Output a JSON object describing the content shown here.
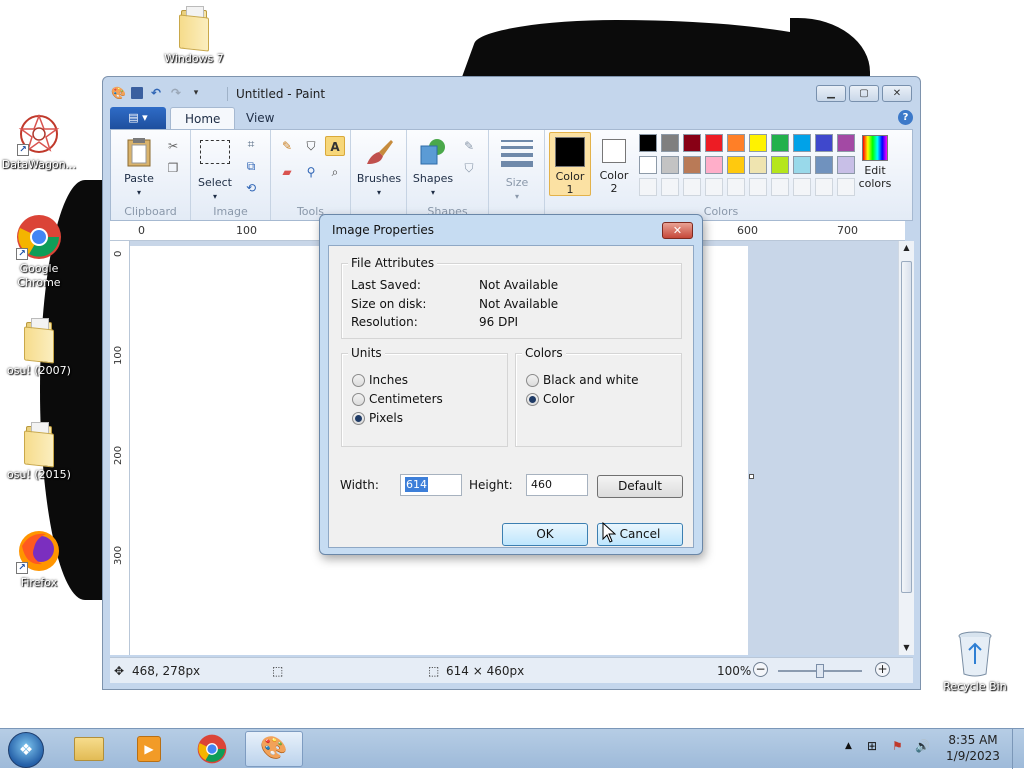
{
  "desktop": {
    "icons": [
      {
        "label": "Windows 7",
        "kind": "folder"
      },
      {
        "label": "DataWagon...",
        "kind": "app"
      },
      {
        "label": "Google Chrome",
        "kind": "chrome"
      },
      {
        "label": "osu! (2007)",
        "kind": "folder"
      },
      {
        "label": "osu! (2015)",
        "kind": "folder"
      },
      {
        "label": "Firefox",
        "kind": "firefox"
      },
      {
        "label": "Recycle Bin",
        "kind": "recycle-bin"
      }
    ]
  },
  "window": {
    "title": "Untitled - Paint",
    "file_menu_label": "",
    "tabs": [
      {
        "label": "Home"
      },
      {
        "label": "View"
      }
    ],
    "active_tab": "Home"
  },
  "ribbon": {
    "groups": {
      "clipboard": {
        "label": "Clipboard",
        "paste_label": "Paste"
      },
      "image": {
        "label": "Image",
        "select_label": "Select"
      },
      "tools": {
        "label": "Tools"
      },
      "brushes": {
        "label": "Brushes"
      },
      "shapes": {
        "label": "Shapes"
      },
      "size": {
        "label": "Size"
      },
      "colors": {
        "label": "Colors",
        "color1_label": "Color\n1",
        "color1_line1": "Color",
        "color1_line2": "1",
        "color2_line1": "Color",
        "color2_line2": "2",
        "edit_line1": "Edit",
        "edit_line2": "colors",
        "color1_value": "#000000",
        "color2_value": "#ffffff",
        "palette_row1": [
          "#000000",
          "#7f7f7f",
          "#880015",
          "#ed1c24",
          "#ff7f27",
          "#fff200",
          "#22b14c",
          "#00a2e8",
          "#3f48cc",
          "#a349a4"
        ],
        "palette_row2": [
          "#ffffff",
          "#c3c3c3",
          "#b97a57",
          "#ffaec9",
          "#ffc90e",
          "#efe4b0",
          "#b5e61d",
          "#99d9ea",
          "#7092be",
          "#c8bfe7"
        ]
      }
    }
  },
  "rulers": {
    "h_ticks": [
      "0",
      "100",
      "600",
      "700"
    ],
    "v_ticks": [
      "0",
      "100",
      "200",
      "300"
    ]
  },
  "statusbar": {
    "cursor_pos": "468, 278px",
    "canvas_size": "614 × 460px",
    "zoom": "100%"
  },
  "dialog": {
    "title": "Image Properties",
    "file_attributes": {
      "legend": "File Attributes",
      "rows": [
        {
          "key": "Last Saved:",
          "value": "Not Available"
        },
        {
          "key": "Size on disk:",
          "value": "Not Available"
        },
        {
          "key": "Resolution:",
          "value": "96 DPI"
        }
      ]
    },
    "units": {
      "legend": "Units",
      "options": [
        {
          "label": "Inches",
          "selected": false
        },
        {
          "label": "Centimeters",
          "selected": false
        },
        {
          "label": "Pixels",
          "selected": true
        }
      ]
    },
    "colors": {
      "legend": "Colors",
      "options": [
        {
          "label": "Black and white",
          "selected": false
        },
        {
          "label": "Color",
          "selected": true
        }
      ]
    },
    "width_label": "Width:",
    "width_value": "614",
    "height_label": "Height:",
    "height_value": "460",
    "default_label": "Default",
    "ok_label": "OK",
    "cancel_label": "Cancel"
  },
  "taskbar": {
    "time": "8:35 AM",
    "date": "1/9/2023"
  },
  "colors": {
    "accent": "#1e4f9e",
    "dialog_frame": "#c6dcf2",
    "selection": "#3d7fd9"
  }
}
